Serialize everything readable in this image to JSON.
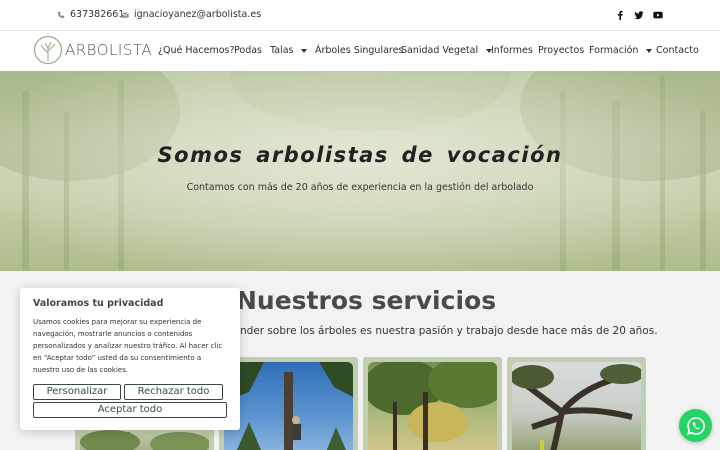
{
  "topbar": {
    "phone": "637382661",
    "email": "ignacioyanez@arbolista.es",
    "social_icons": [
      "facebook-icon",
      "twitter-icon",
      "youtube-icon"
    ]
  },
  "brand": {
    "name": "ARBOLISTA"
  },
  "nav": {
    "items": [
      {
        "label": "¿Qué Hacemos?",
        "dropdown": false
      },
      {
        "label": "Podas",
        "dropdown": false
      },
      {
        "label": "Talas",
        "dropdown": true
      },
      {
        "label": "Árboles Singulares",
        "dropdown": false
      },
      {
        "label": "Sanidad Vegetal",
        "dropdown": true
      },
      {
        "label": "Informes",
        "dropdown": false
      },
      {
        "label": "Proyectos",
        "dropdown": false
      },
      {
        "label": "Formación",
        "dropdown": true
      },
      {
        "label": "Contacto",
        "dropdown": false
      }
    ]
  },
  "hero": {
    "title": "Somos arbolistas de vocación",
    "subtitle": "Contamos con más de 20 años de experiencia en la gestión del arbolado"
  },
  "services": {
    "title": "Nuestros servicios",
    "subtitle": "nder sobre los árboles es nuestra pasión y trabajo desde hace más de 20 años."
  },
  "cookie": {
    "title": "Valoramos tu privacidad",
    "text": "Usamos cookies para mejorar su experiencia de navegación, mostrarle anuncios o contenidos personalizados y analizar nuestro tráfico. Al hacer clic en “Aceptar todo” usted da su consentimiento a nuestro uso de las cookies.",
    "customize": "Personalizar",
    "reject": "Rechazar todo",
    "accept": "Aceptar todo"
  },
  "colors": {
    "accent": "#3b4a42",
    "card_frame": "#c2ceb0",
    "whatsapp": "#25d366"
  }
}
